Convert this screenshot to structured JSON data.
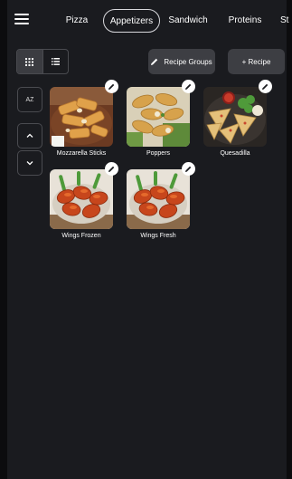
{
  "header": {
    "menu_icon": "hamburger-menu-icon",
    "tabs": [
      {
        "label": "Pizza",
        "active": false
      },
      {
        "label": "Appetizers",
        "active": true
      },
      {
        "label": "Sandwich",
        "active": false
      },
      {
        "label": "Proteins",
        "active": false
      },
      {
        "label": "St",
        "active": false
      }
    ]
  },
  "toolbar": {
    "grid_view_icon": "grid-icon",
    "list_view_icon": "list-icon",
    "recipe_groups_label": "Recipe Groups",
    "add_recipe_label": "+ Recipe"
  },
  "side_controls": {
    "sort_label": "AZ",
    "move_up_icon": "chevron-up-icon",
    "move_down_icon": "chevron-down-icon"
  },
  "recipes": [
    {
      "name": "Mozzarella Sticks",
      "image": "mozzarella-sticks-photo"
    },
    {
      "name": "Poppers",
      "image": "poppers-photo"
    },
    {
      "name": "Quesadilla",
      "image": "quesadilla-photo"
    },
    {
      "name": "Wings Frozen",
      "image": "buffalo-wings-photo"
    },
    {
      "name": "Wings Fresh",
      "image": "buffalo-wings-photo"
    }
  ],
  "colors": {
    "background": "#1a1b1f",
    "button": "#3d3e43",
    "border": "#4a4b50",
    "text": "#ffffff"
  }
}
